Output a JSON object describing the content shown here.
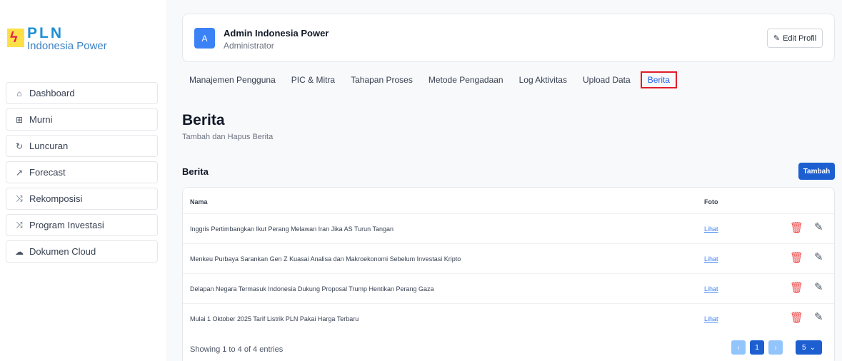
{
  "logo": {
    "brand": "PLN",
    "sub": "Indonesia Power"
  },
  "sidebar": {
    "items": [
      {
        "label": "Dashboard",
        "icon": "home-icon"
      },
      {
        "label": "Murni",
        "icon": "file-plus-icon"
      },
      {
        "label": "Luncuran",
        "icon": "refresh-icon"
      },
      {
        "label": "Forecast",
        "icon": "trend-icon"
      },
      {
        "label": "Rekomposisi",
        "icon": "shuffle-icon"
      },
      {
        "label": "Program Investasi",
        "icon": "shuffle-icon"
      },
      {
        "label": "Dokumen Cloud",
        "icon": "cloud-icon"
      }
    ]
  },
  "profile": {
    "initial": "A",
    "name": "Admin Indonesia Power",
    "role": "Administrator",
    "edit_label": "Edit Profil"
  },
  "tabs": [
    {
      "label": "Manajemen Pengguna"
    },
    {
      "label": "PIC & Mitra"
    },
    {
      "label": "Tahapan Proses"
    },
    {
      "label": "Metode Pengadaan"
    },
    {
      "label": "Log Aktivitas"
    },
    {
      "label": "Upload Data"
    },
    {
      "label": "Berita"
    }
  ],
  "page": {
    "title": "Berita",
    "subtitle": "Tambah dan Hapus Berita",
    "section_title": "Berita",
    "add_label": "Tambah"
  },
  "table": {
    "headers": {
      "name": "Nama",
      "photo": "Foto"
    },
    "rows": [
      {
        "name": "Inggris Pertimbangkan Ikut Perang Melawan Iran Jika AS Turun Tangan",
        "photo": "Lihat"
      },
      {
        "name": "Menkeu Purbaya Sarankan Gen Z Kuasai Analisa dan Makroekonomi Sebelum Investasi Kripto",
        "photo": "Lihat"
      },
      {
        "name": "Delapan Negara Termasuk Indonesia Dukung Proposal Trump Hentikan Perang Gaza",
        "photo": "Lihat"
      },
      {
        "name": "Mulai 1 Oktober 2025 Tarif Listrik PLN Pakai Harga Terbaru",
        "photo": "Lihat"
      }
    ],
    "showing": "Showing 1 to 4 of 4 entries",
    "current_page": "1",
    "per_page": "5"
  },
  "colors": {
    "accent": "#1d5fd1",
    "danger": "#ef4444",
    "highlight": "#e11d2a"
  }
}
